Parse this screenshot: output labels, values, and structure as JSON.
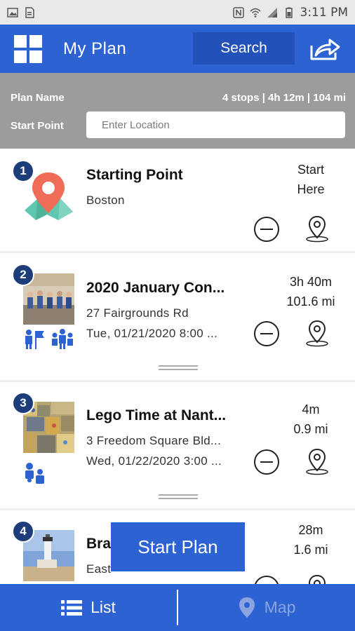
{
  "status_bar": {
    "time": "3:11 PM"
  },
  "header": {
    "title": "My Plan",
    "search_label": "Search",
    "colors": {
      "primary": "#2d62d2",
      "dark": "#1d3d7a"
    }
  },
  "plan": {
    "name_label": "Plan Name",
    "summary": "4 stops | 4h 12m | 104 mi",
    "start_point_label": "Start Point",
    "location_placeholder": "Enter Location"
  },
  "stops": [
    {
      "number": "1",
      "title": "Starting Point",
      "line1": "Boston",
      "line2": "",
      "meta1": "Start",
      "meta2": "Here",
      "icon": "map-pin-icon"
    },
    {
      "number": "2",
      "title": "2020 January Con...",
      "line1": "27 Fairgrounds Rd",
      "line2": "Tue, 01/21/2020 8:00 ...",
      "meta1": "3h 40m",
      "meta2": "101.6 mi",
      "icon": "event-photo"
    },
    {
      "number": "3",
      "title": "Lego Time at Nant...",
      "line1": "3 Freedom Square Bld...",
      "line2": "Wed, 01/22/2020 3:00 ...",
      "meta1": "4m",
      "meta2": "0.9 mi",
      "icon": "lego-photo"
    },
    {
      "number": "4",
      "title": "Bra",
      "line1": "East",
      "line2": "",
      "meta1": "28m",
      "meta2": "1.6 mi",
      "icon": "lighthouse-photo"
    }
  ],
  "start_plan_label": "Start Plan",
  "nav": {
    "list_label": "List",
    "map_label": "Map"
  }
}
